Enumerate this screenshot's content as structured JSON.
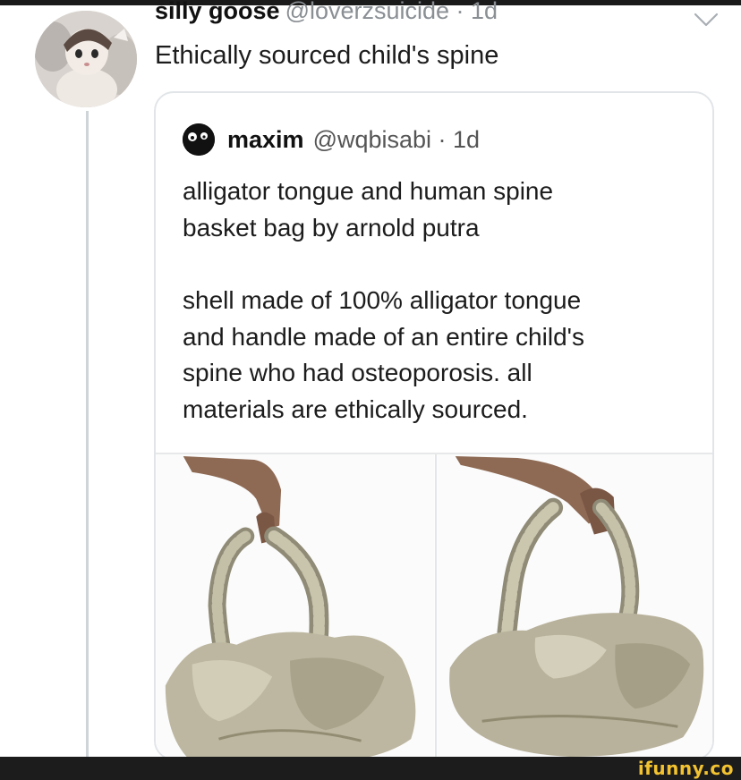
{
  "tweet": {
    "author_name": "silly goose",
    "author_handle": "@loverzsuicide",
    "time": " · 1d",
    "text": "Ethically sourced child's spine"
  },
  "quoted_tweet": {
    "author_name": "maxim",
    "author_handle": "@wqbisabi · 1d",
    "lines_1": [
      "alligator tongue and human spine",
      "basket bag by arnold putra"
    ],
    "lines_2": [
      "shell made of 100% alligator tongue",
      "and handle made of an entire child's",
      "spine who had osteoporosis. all",
      "materials are ethically sourced."
    ]
  },
  "icons": {
    "menu": "chevron-down-icon",
    "avatar": "user-avatar",
    "quoted_avatar": "user-avatar"
  },
  "watermark": "ifunny.co",
  "colors": {
    "watermark": "#f2c230",
    "muted_text": "#8a8f94",
    "border": "#e2e5e8",
    "background": "#ffffff"
  }
}
